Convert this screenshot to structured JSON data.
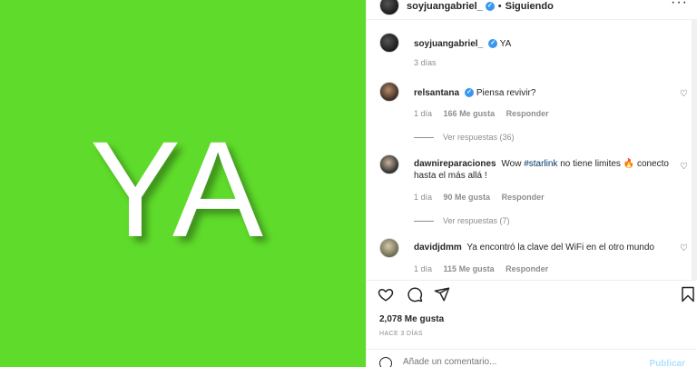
{
  "header": {
    "username": "soyjuangabriel_",
    "dot": "•",
    "following_label": "Siguiendo",
    "more_icon": "more-horizontal-icon"
  },
  "post": {
    "image_text": "YA",
    "image_bg": "#5fdc2b",
    "caption_user": "soyjuangabriel_",
    "caption_text": "YA",
    "caption_time": "3 días"
  },
  "comments": [
    {
      "user": "relsantana",
      "verified": true,
      "text": "Piensa revivir?",
      "time": "1 día",
      "likes": "166 Me gusta",
      "reply": "Responder",
      "replies": "Ver respuestas (36)"
    },
    {
      "user": "dawnireparaciones",
      "verified": false,
      "text_before": "Wow ",
      "hashtag": "#starlink",
      "text_after": " no tiene limites 🔥 conecto hasta el más allá !",
      "time": "1 día",
      "likes": "90 Me gusta",
      "reply": "Responder",
      "replies": "Ver respuestas (7)"
    },
    {
      "user": "davidjdmm",
      "verified": false,
      "text": "Ya encontró la clave del WiFi en el otro mundo",
      "time": "1 día",
      "likes": "115 Me gusta",
      "reply": "Responder"
    }
  ],
  "actions": {
    "like_icon": "heart-icon",
    "comment_icon": "comment-icon",
    "share_icon": "share-icon",
    "save_icon": "bookmark-icon"
  },
  "stats": {
    "likes": "2,078 Me gusta",
    "time_ago": "HACE 3 DÍAS"
  },
  "add_comment": {
    "placeholder": "Añade un comentario...",
    "publish": "Publicar"
  },
  "colors": {
    "verified": "#3897f0",
    "link": "#00376b",
    "muted": "#8e8e8e"
  }
}
